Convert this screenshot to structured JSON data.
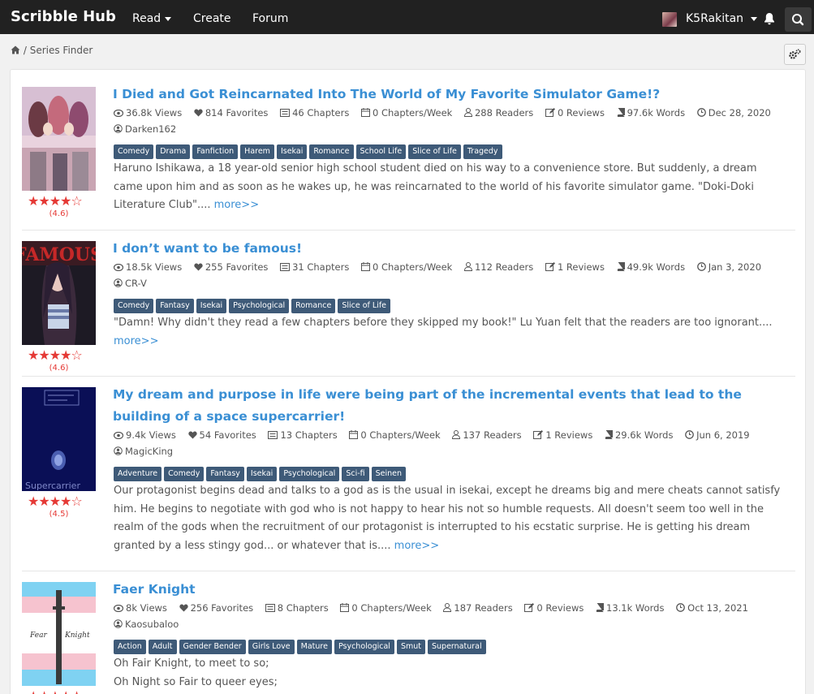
{
  "nav": {
    "brand": "Scribble Hub",
    "read": "Read",
    "create": "Create",
    "forum": "Forum",
    "username": "K5Rakitan"
  },
  "breadcrumb": {
    "sep": "/",
    "current": "Series Finder"
  },
  "series": [
    {
      "title": "I Died and Got Reincarnated Into The World of My Favorite Simulator Game!?",
      "views": "36.8k Views",
      "favorites": "814 Favorites",
      "chapters": "46 Chapters",
      "per_week": "0 Chapters/Week",
      "readers": "288 Readers",
      "reviews": "0 Reviews",
      "words": "97.6k Words",
      "date": "Dec 28, 2020",
      "author": "Darken162",
      "rating": "(4.6)",
      "stars": "★★★★☆",
      "tags": [
        "Comedy",
        "Drama",
        "Fanfiction",
        "Harem",
        "Isekai",
        "Romance",
        "School Life",
        "Slice of Life",
        "Tragedy"
      ],
      "desc": "Haruno Ishikawa, a 18 year-old senior high school student died on his way to a convenience store. But suddenly, a dream came upon him and as soon as he wakes up, he was reincarnated to the world of his favorite simulator game. \"Doki-Doki Literature Club\"....",
      "more": "more>>"
    },
    {
      "title": "I don’t want to be famous!",
      "views": "18.5k Views",
      "favorites": "255 Favorites",
      "chapters": "31 Chapters",
      "per_week": "0 Chapters/Week",
      "readers": "112 Readers",
      "reviews": "1 Reviews",
      "words": "49.9k Words",
      "date": "Jan 3, 2020",
      "author": "CR-V",
      "rating": "(4.6)",
      "stars": "★★★★☆",
      "tags": [
        "Comedy",
        "Fantasy",
        "Isekai",
        "Psychological",
        "Romance",
        "Slice of Life"
      ],
      "desc": "\"Damn! Why didn't they read a few chapters before they skipped my book!\" Lu Yuan felt that the readers are too ignorant....",
      "more": "more>>"
    },
    {
      "title": "My dream and purpose in life were being part of the incremental events that lead to the building of a space supercarrier!",
      "views": "9.4k Views",
      "favorites": "54 Favorites",
      "chapters": "13 Chapters",
      "per_week": "0 Chapters/Week",
      "readers": "137 Readers",
      "reviews": "1 Reviews",
      "words": "29.6k Words",
      "date": "Jun 6, 2019",
      "author": "MagicKing",
      "rating": "(4.5)",
      "stars": "★★★★☆",
      "tags": [
        "Adventure",
        "Comedy",
        "Fantasy",
        "Isekai",
        "Psychological",
        "Sci-fi",
        "Seinen"
      ],
      "desc": "Our protagonist begins dead and talks to a god as is the usual in isekai, except he dreams big and mere cheats cannot satisfy him. He begins to negotiate with god who is not happy to hear his not so humble requests. All doesn't seem too well in the realm of the gods when the recruitment of our protagonist is interrupted to his ecstatic surprise. He is getting his dream granted by a less stingy god... or whatever that is....",
      "more": "more>>"
    },
    {
      "title": "Faer Knight",
      "views": "8k Views",
      "favorites": "256 Favorites",
      "chapters": "8 Chapters",
      "per_week": "0 Chapters/Week",
      "readers": "187 Readers",
      "reviews": "0 Reviews",
      "words": "13.1k Words",
      "date": "Oct 13, 2021",
      "author": "Kaosubaloo",
      "rating": "",
      "stars": "★★★★★",
      "tags": [
        "Action",
        "Adult",
        "Gender Bender",
        "Girls Love",
        "Mature",
        "Psychological",
        "Smut",
        "Supernatural"
      ],
      "desc_line1": "Oh Fair Knight, to meet to so;",
      "desc_line2": "Oh Night so Fair to queer eyes;",
      "cover_text_left": "Fear",
      "cover_text_right": "Knight"
    }
  ],
  "covers": {
    "c2_text": "FAMOUS",
    "c3_text": "Supercarrier"
  }
}
